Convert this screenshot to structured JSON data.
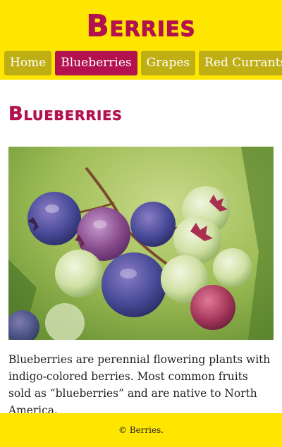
{
  "header": {
    "site_title": "Berries",
    "nav": [
      {
        "label": "Home",
        "active": false
      },
      {
        "label": "Blueberries",
        "active": true
      },
      {
        "label": "Grapes",
        "active": false
      },
      {
        "label": "Red Currants",
        "active": false
      }
    ]
  },
  "main": {
    "title": "Blueberries",
    "image_icon": "blueberries-photo",
    "description": "Blueberries are perennial flowering plants with indigo-colored berries. Most common fruits sold as “blueberries” and are native to North America."
  },
  "footer": {
    "text": "© Berries."
  },
  "colors": {
    "header_bg": "#ffe600",
    "accent": "#b3124e",
    "nav_bg": "#bfae14"
  }
}
